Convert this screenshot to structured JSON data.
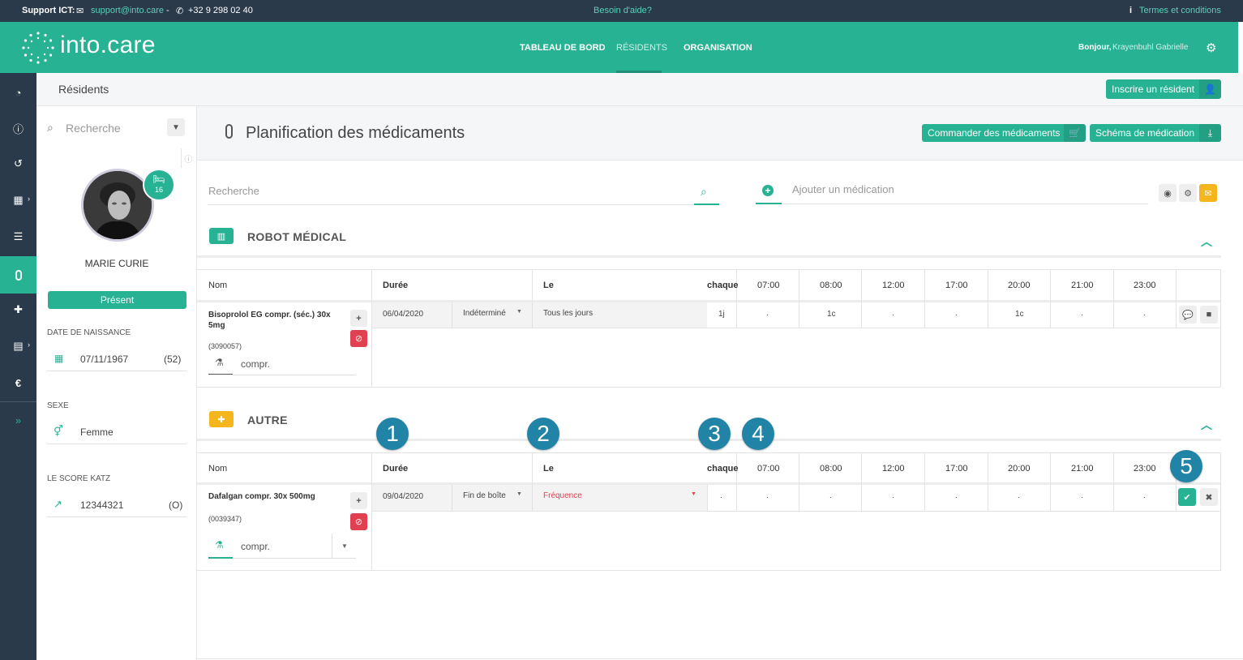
{
  "topbar": {
    "support_label": "Support ICT:",
    "email": "support@into.care",
    "dash": "-",
    "phone": "+32 9 298 02 40",
    "help": "Besoin d'aide?",
    "terms": "Termes et conditions"
  },
  "header": {
    "logo": "into.care",
    "nav": [
      "TABLEAU DE BORD",
      "RÉSIDENTS",
      "ORGANISATION"
    ],
    "greeting": "Bonjour,",
    "user": "Krayenbuhl Gabrielle"
  },
  "subheader": {
    "title": "Résidents",
    "enroll_button": "Inscrire un résident"
  },
  "resident": {
    "search_placeholder": "Recherche",
    "room": "16",
    "name": "MARIE CURIE",
    "status": "Présent",
    "birth_label": "DATE DE NAISSANCE",
    "birth_date": "07/11/1967",
    "age": "(52)",
    "sex_label": "SEXE",
    "sex": "Femme",
    "katz_label": "LE SCORE KATZ",
    "katz": "12344321",
    "katz_code": "(O)"
  },
  "main": {
    "title": "Planification des médicaments",
    "order_button": "Commander des médicaments",
    "schema_button": "Schéma de médication",
    "search_placeholder": "Recherche",
    "add_placeholder": "Ajouter un médication"
  },
  "columns": {
    "nom": "Nom",
    "duree": "Durée",
    "le": "Le",
    "chaque": "chaque",
    "times": [
      "07:00",
      "08:00",
      "12:00",
      "17:00",
      "20:00",
      "21:00",
      "23:00"
    ]
  },
  "sections": [
    {
      "title": "ROBOT MÉDICAL",
      "row": {
        "name_line1": "Bisoprolol EG compr. (séc.) 30x",
        "name_line2": "5mg",
        "code": "(3090057)",
        "unit": "compr.",
        "date": "06/04/2020",
        "duration": "Indéterminé",
        "le": "Tous les jours",
        "every": "1j",
        "doses": [
          ".",
          "1c",
          ".",
          ".",
          "1c",
          ".",
          "."
        ]
      }
    },
    {
      "title": "AUTRE",
      "row": {
        "name_line1": "Dafalgan compr. 30x 500mg",
        "code": "(0039347)",
        "unit": "compr.",
        "date": "09/04/2020",
        "duration": "Fin de boîte",
        "le": "Fréquence",
        "every": ".",
        "doses": [
          ".",
          ".",
          ".",
          ".",
          ".",
          ".",
          "."
        ]
      }
    }
  ],
  "callouts": [
    "1",
    "2",
    "3",
    "4",
    "5"
  ],
  "colors": {
    "brand": "#27b294",
    "navy": "#2a3a4a",
    "callout": "#2183a5",
    "danger": "#e04050",
    "warning": "#f5b51c"
  }
}
